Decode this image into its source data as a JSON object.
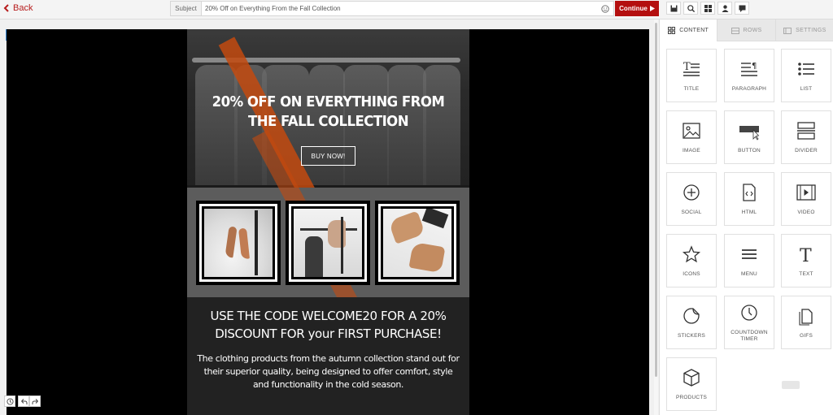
{
  "topbar": {
    "back_label": "Back",
    "subject_label": "Subject",
    "subject_value": "20% Off on Everything From the Fall Collection",
    "continue_label": "Continue"
  },
  "email": {
    "hero_title": "20% OFF ON EVERYTHING FROM THE FALL COLLECTION",
    "buy_button": "BUY NOW!",
    "code_title": "USE THE CODE WELCOME20 FOR A 20% DISCOUNT FOR your FIRST PURCHASE!",
    "body_text": "The clothing products from the autumn collection stand out for their superior quality, being designed to offer comfort, style and functionality in the cold season."
  },
  "panel": {
    "tabs": [
      {
        "label": "CONTENT",
        "icon": "grid-icon"
      },
      {
        "label": "ROWS",
        "icon": "rows-icon"
      },
      {
        "label": "SETTINGS",
        "icon": "settings-icon"
      }
    ],
    "blocks": [
      {
        "label": "TITLE",
        "icon": "title-icon"
      },
      {
        "label": "PARAGRAPH",
        "icon": "paragraph-icon"
      },
      {
        "label": "LIST",
        "icon": "list-icon"
      },
      {
        "label": "IMAGE",
        "icon": "image-icon"
      },
      {
        "label": "BUTTON",
        "icon": "button-icon"
      },
      {
        "label": "DIVIDER",
        "icon": "divider-icon"
      },
      {
        "label": "SOCIAL",
        "icon": "social-icon"
      },
      {
        "label": "HTML",
        "icon": "html-icon"
      },
      {
        "label": "VIDEO",
        "icon": "video-icon"
      },
      {
        "label": "ICONS",
        "icon": "star-icon"
      },
      {
        "label": "MENU",
        "icon": "menu-icon"
      },
      {
        "label": "TEXT",
        "icon": "text-icon"
      },
      {
        "label": "STICKERS",
        "icon": "sticker-icon"
      },
      {
        "label": "COUNTDOWN TIMER",
        "icon": "clock-icon"
      },
      {
        "label": "GIFS",
        "icon": "gif-icon"
      },
      {
        "label": "PRODUCTS",
        "icon": "box-icon"
      }
    ]
  },
  "colors": {
    "accent": "#b40f0f",
    "stripe": "#c34a0f",
    "device_active": "#3b8fe0"
  }
}
